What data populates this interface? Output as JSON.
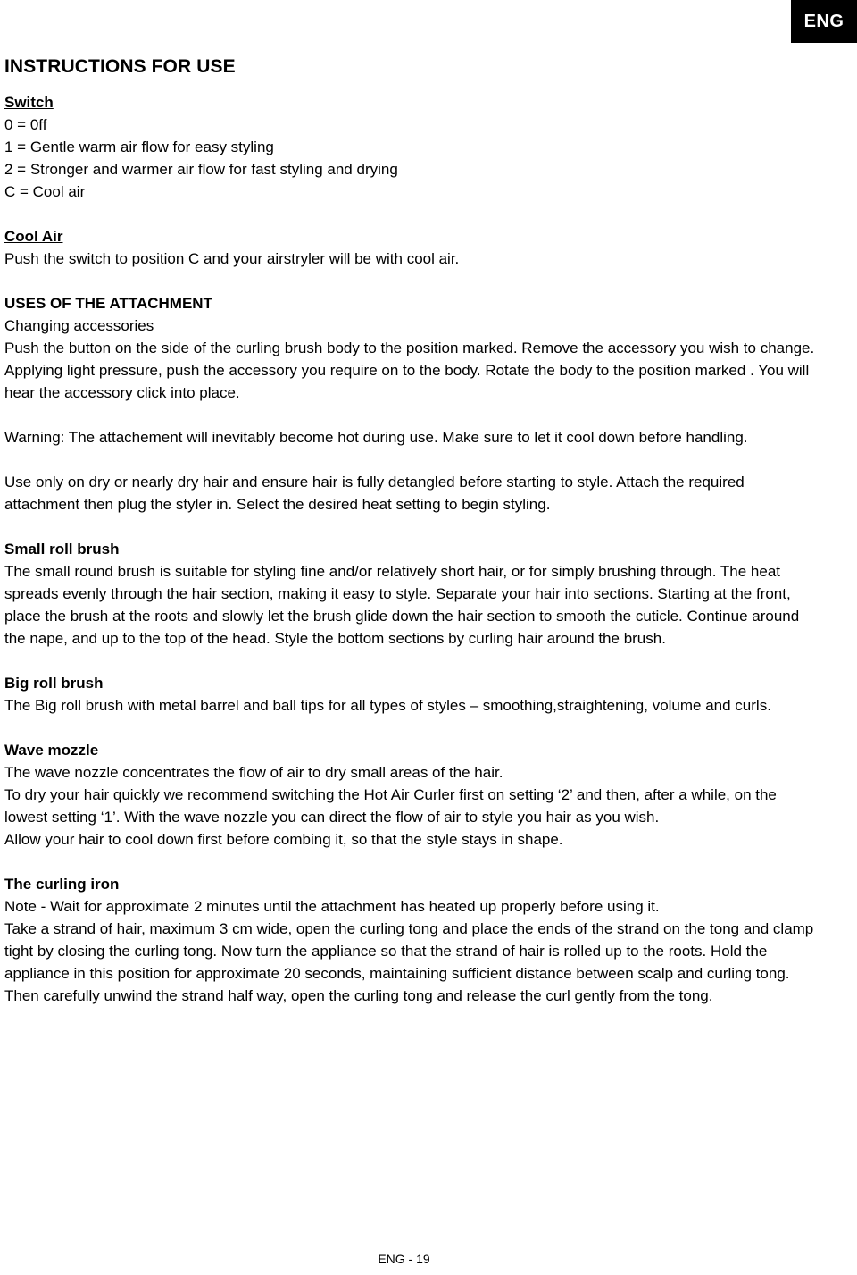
{
  "badge": {
    "label": "ENG",
    "background": "#000000",
    "color": "#ffffff"
  },
  "document": {
    "title": "INSTRUCTIONS FOR USE"
  },
  "sections": {
    "switch": {
      "heading": "Switch",
      "items": [
        "0 = 0ff",
        "1 = Gentle warm air flow for easy styling",
        "2 = Stronger and warmer air flow for fast styling and drying",
        "C = Cool air"
      ]
    },
    "cool_air": {
      "heading": "Cool Air",
      "body": "Push the switch to position C and your airstryler will be with cool air."
    },
    "uses": {
      "heading": "USES OF THE ATTACHMENT",
      "subheading": "Changing accessories",
      "para1": "Push the button on the side of the curling brush body to the position marked. Remove the accessory you wish to change.",
      "para2": "Applying light pressure, push the accessory you require on to the body. Rotate the body to the position marked . You will hear the accessory click into place.",
      "para3": "Warning: The attachement will inevitably become hot during use. Make sure to let it cool down before handling.",
      "para4": "Use only on dry or nearly dry hair and ensure hair is fully detangled before starting to style. Attach the required attachment then plug the styler in. Select the desired heat setting to begin styling."
    },
    "small_roll_brush": {
      "heading": "Small roll brush",
      "body": "The small round brush is suitable for styling fine and/or relatively short hair, or for simply brushing through. The heat spreads evenly through the hair section, making it easy to style. Separate your hair into sections. Starting at the front, place the brush at the roots and slowly let the brush glide down the hair section to smooth the cuticle. Continue around the nape, and up to the top of the head. Style the bottom sections by curling hair around the brush."
    },
    "big_roll_brush": {
      "heading": "Big roll brush",
      "body": "The Big roll brush with metal barrel and ball tips for all types of styles – smoothing,straightening, volume and curls."
    },
    "wave_mozzle": {
      "heading": "Wave mozzle",
      "para1": "The wave nozzle concentrates the flow of air to dry small areas of the hair.",
      "para2": "To dry your hair quickly we recommend switching the Hot Air Curler first on setting ‘2’ and then, after a while, on the lowest setting ‘1’. With the wave nozzle you can direct the flow of air to style you hair as you wish.",
      "para3": "Allow your hair to cool down first before combing it, so that the style stays in shape."
    },
    "curling_iron": {
      "heading": "The curling iron",
      "para1": "Note - Wait for approximate 2 minutes until the attachment has heated up properly before using it.",
      "para2": "Take a strand of hair, maximum 3 cm wide, open the curling tong and place the ends of the strand on the tong and clamp tight by closing the curling tong. Now turn the appliance so that the strand of hair is rolled up to the roots. Hold the appliance in this position for approximate 20 seconds, maintaining sufficient distance between scalp and curling tong. Then carefully unwind the strand half way, open the curling tong and release the curl gently from the tong."
    }
  },
  "footer": {
    "page_label": "ENG - 19"
  }
}
